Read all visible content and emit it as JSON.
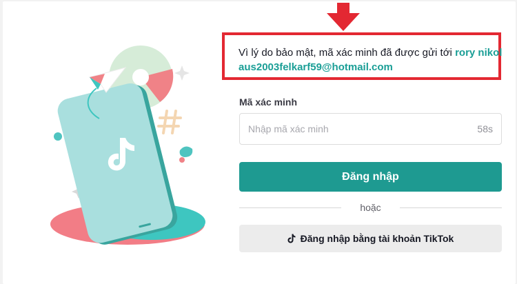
{
  "notice": {
    "message": "Vì lý do bảo mật, mã xác minh đã được gửi tới",
    "email": "rory nikolaus2003felkarf59@hotmail.com"
  },
  "form": {
    "code_label": "Mã xác minh",
    "code_placeholder": "Nhập mã xác minh",
    "code_value": "",
    "countdown": "58s",
    "login_label": "Đăng nhập",
    "or_label": "hoặc",
    "tiktok_label": "Đăng nhập bằng tài khoản TikTok"
  },
  "icons": {
    "annotation_arrow": "arrow-down-icon",
    "tiktok_logo": "tiktok-logo-icon",
    "illustration": "phone-illustration"
  },
  "colors": {
    "accent": "#1e9a91",
    "email_text": "#1a9e96",
    "highlight_border": "#e32832",
    "secondary_button": "#ececec"
  }
}
